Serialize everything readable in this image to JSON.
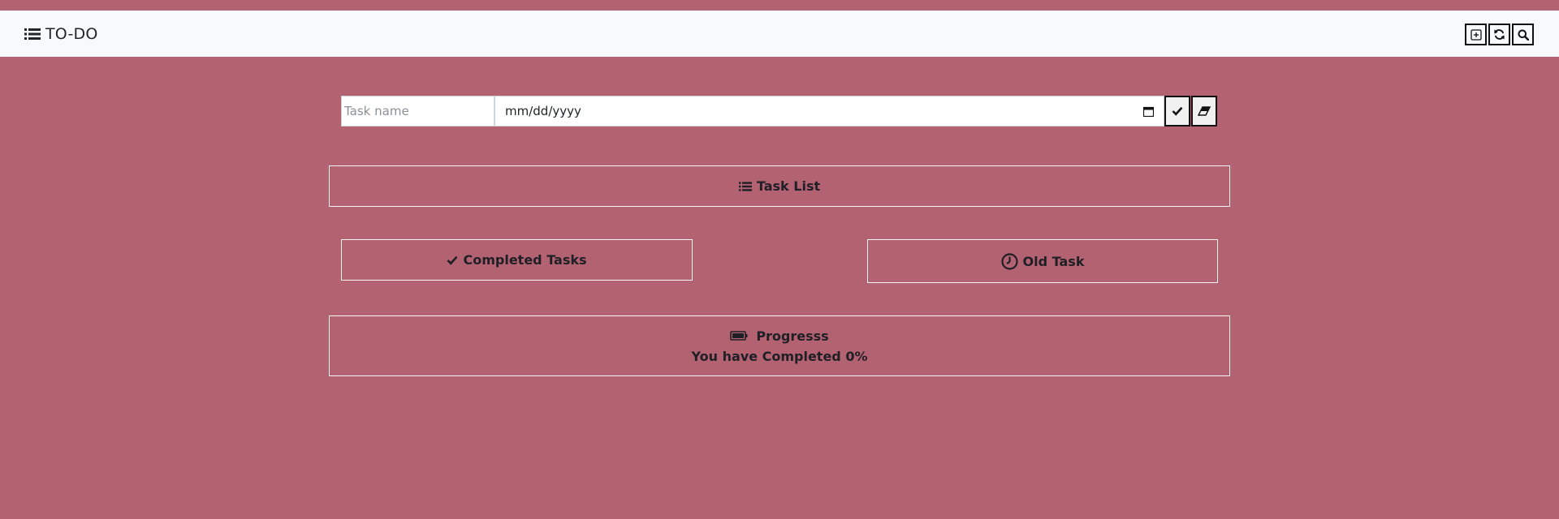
{
  "app": {
    "brand": "TO-DO",
    "icons": {
      "brand": "list-icon",
      "add": "plus-square-icon",
      "refresh": "refresh-icon",
      "search": "search-icon"
    }
  },
  "form": {
    "task_placeholder": "Task name",
    "date_placeholder": "mm/dd/yyyy",
    "submit_icon": "check-icon",
    "clear_icon": "eraser-icon"
  },
  "sections": {
    "task_list": "Task List",
    "completed": "Completed Tasks",
    "old": "Old Task",
    "progress_title": "Progresss",
    "progress_text": "You have Completed 0%"
  },
  "progress": {
    "percent": 0
  },
  "colors": {
    "background": "#b36272",
    "navbar": "#f8f9fa",
    "text": "#212529",
    "border": "#f4f4f4"
  }
}
